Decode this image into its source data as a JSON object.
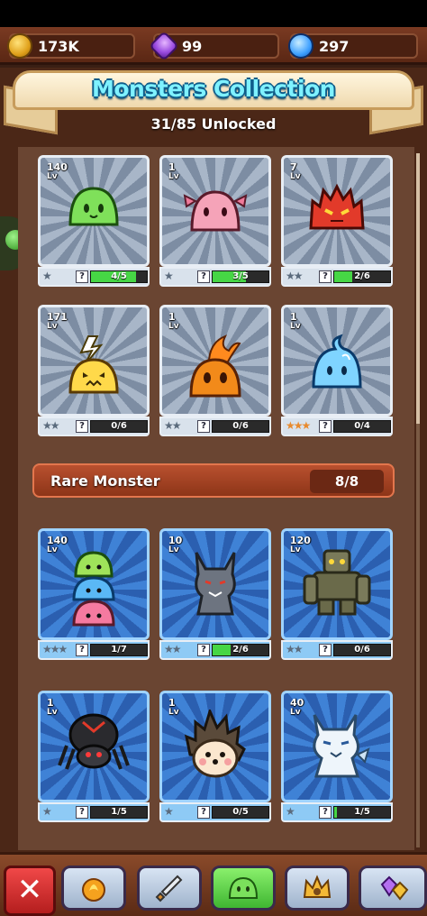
{
  "currency": {
    "coins": "173K",
    "gems": "99",
    "crystals": "297"
  },
  "header": {
    "title": "Monsters Collection",
    "unlocked": "31/85 Unlocked"
  },
  "common_cards": [
    {
      "level": "140",
      "lv": "Lv",
      "stars": 1,
      "max_stars": 1,
      "progress": "4/5",
      "fill": 0.8,
      "monster": "green-slime"
    },
    {
      "level": "1",
      "lv": "Lv",
      "stars": 1,
      "max_stars": 1,
      "progress": "3/5",
      "fill": 0.6,
      "monster": "pink-axolotl-slime"
    },
    {
      "level": "7",
      "lv": "Lv",
      "stars": 2,
      "max_stars": 2,
      "progress": "2/6",
      "fill": 0.33,
      "monster": "red-spiky-slime"
    },
    {
      "level": "171",
      "lv": "Lv",
      "stars": 2,
      "max_stars": 2,
      "progress": "0/6",
      "fill": 0,
      "monster": "yellow-thunder-slime"
    },
    {
      "level": "1",
      "lv": "Lv",
      "stars": 2,
      "max_stars": 2,
      "progress": "0/6",
      "fill": 0,
      "monster": "fire-slime"
    },
    {
      "level": "1",
      "lv": "Lv",
      "stars": 3,
      "max_stars": 3,
      "progress": "0/4",
      "fill": 0,
      "monster": "water-slime"
    }
  ],
  "rare_section": {
    "title": "Rare Monster",
    "count": "8/8"
  },
  "rare_cards": [
    {
      "level": "140",
      "lv": "Lv",
      "stars": 3,
      "progress": "1/7",
      "fill": 0,
      "monster": "slime-stack"
    },
    {
      "level": "10",
      "lv": "Lv",
      "stars": 2,
      "progress": "2/6",
      "fill": 0.33,
      "monster": "gray-wolf"
    },
    {
      "level": "120",
      "lv": "Lv",
      "stars": 2,
      "progress": "0/6",
      "fill": 0,
      "monster": "stone-golem"
    },
    {
      "level": "1",
      "lv": "Lv",
      "stars": 1,
      "progress": "1/5",
      "fill": 0,
      "monster": "black-spider"
    },
    {
      "level": "1",
      "lv": "Lv",
      "stars": 1,
      "progress": "0/5",
      "fill": 0,
      "monster": "hedgehog"
    },
    {
      "level": "40",
      "lv": "Lv",
      "stars": 1,
      "progress": "1/5",
      "fill": 0.05,
      "monster": "ice-wolf"
    }
  ],
  "nav": {
    "close_icon": "close-icon",
    "items": [
      "fire-orb-icon",
      "sword-icon",
      "slime-icon",
      "crown-icon",
      "gems-icon"
    ],
    "active": "slime-icon"
  },
  "colors": {
    "accent_title": "#7ff2ff",
    "progress_fill": "#46d645",
    "star_on": "#e88a2e",
    "close": "#e03030"
  }
}
